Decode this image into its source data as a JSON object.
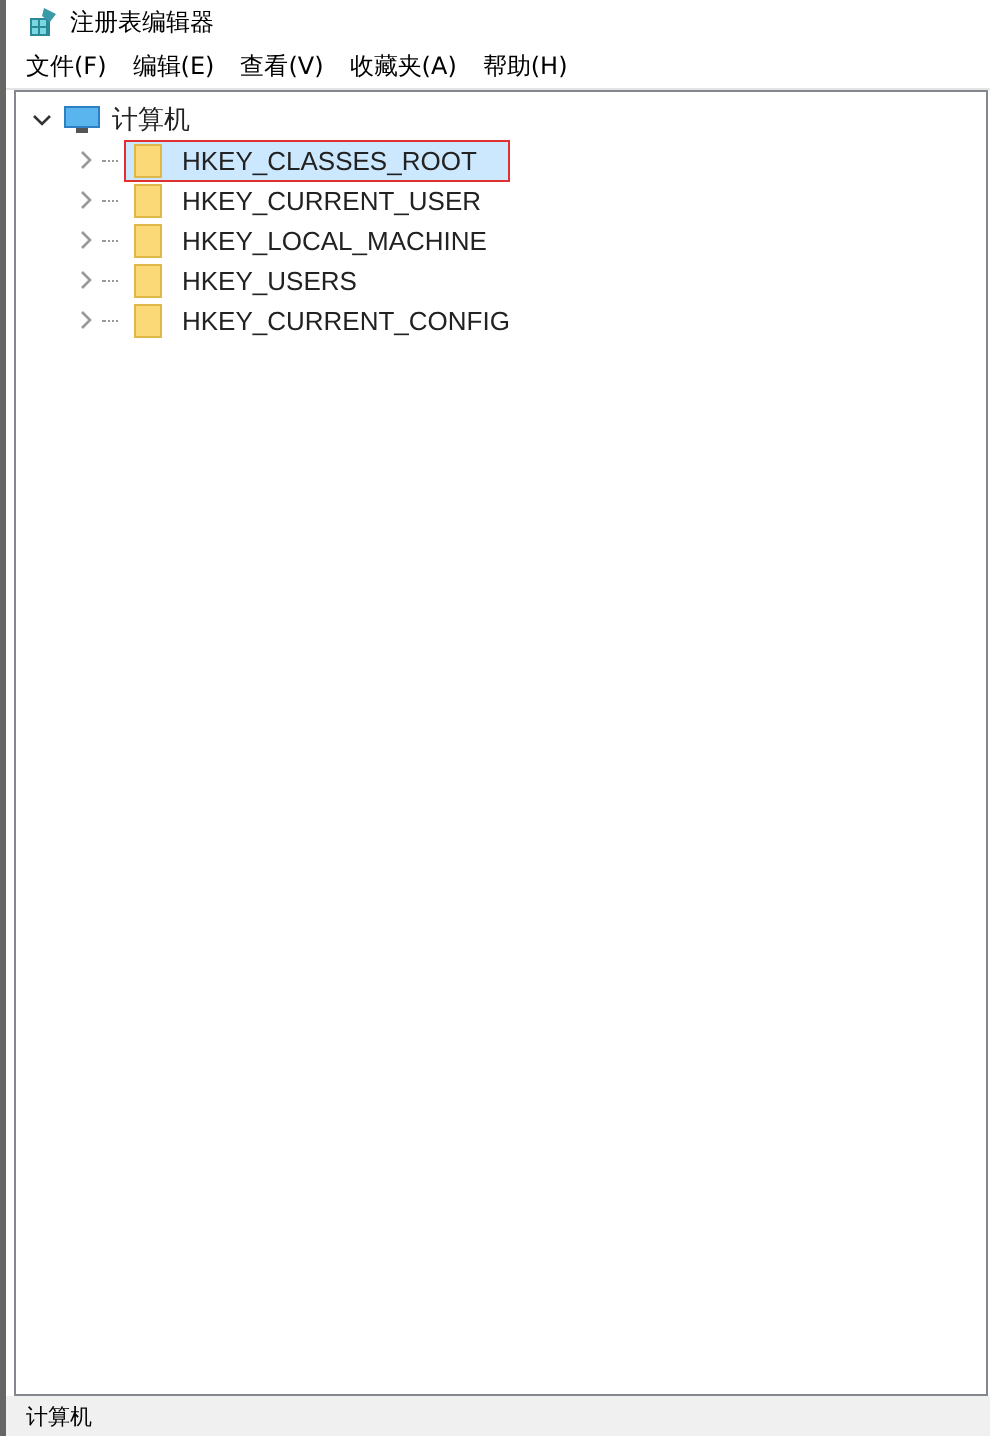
{
  "window": {
    "title": "注册表编辑器"
  },
  "menu": [
    "文件(F)",
    "编辑(E)",
    "查看(V)",
    "收藏夹(A)",
    "帮助(H)"
  ],
  "tree": {
    "label": "计算机",
    "expanded": true,
    "children": [
      {
        "label": "HKEY_CLASSES_ROOT",
        "selected": true,
        "highlighted": true
      },
      {
        "label": "HKEY_CURRENT_USER",
        "selected": false,
        "highlighted": false
      },
      {
        "label": "HKEY_LOCAL_MACHINE",
        "selected": false,
        "highlighted": false
      },
      {
        "label": "HKEY_USERS",
        "selected": false,
        "highlighted": false
      },
      {
        "label": "HKEY_CURRENT_CONFIG",
        "selected": false,
        "highlighted": false
      }
    ]
  },
  "status_bar": "计算机"
}
